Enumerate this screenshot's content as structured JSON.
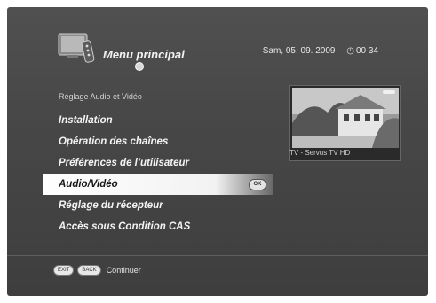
{
  "header": {
    "title": "Menu principal",
    "date": "Sam, 05. 09. 2009",
    "time": "00 34",
    "clock_icon": "clock-icon",
    "logo_icon": "tv-remote-icon"
  },
  "breadcrumb": "Réglage Audio et Vidéo",
  "menu": {
    "items": [
      {
        "label": "Installation"
      },
      {
        "label": "Opération des chaînes"
      },
      {
        "label": "Préférences de l’utilisateur"
      },
      {
        "label": "Audio/Vidéo",
        "badge": "OK"
      },
      {
        "label": "Réglage du récepteur"
      },
      {
        "label": "Accès sous Condition CAS"
      }
    ],
    "selected_index": 3
  },
  "preview": {
    "caption": "TV - Servus TV HD"
  },
  "footer": {
    "exit_label": "EXIT",
    "back_label": "BACK",
    "action_label": "Continuer"
  },
  "colors": {
    "background": "#474747",
    "highlight": "#ffffff",
    "text": "#f4f4f4"
  }
}
